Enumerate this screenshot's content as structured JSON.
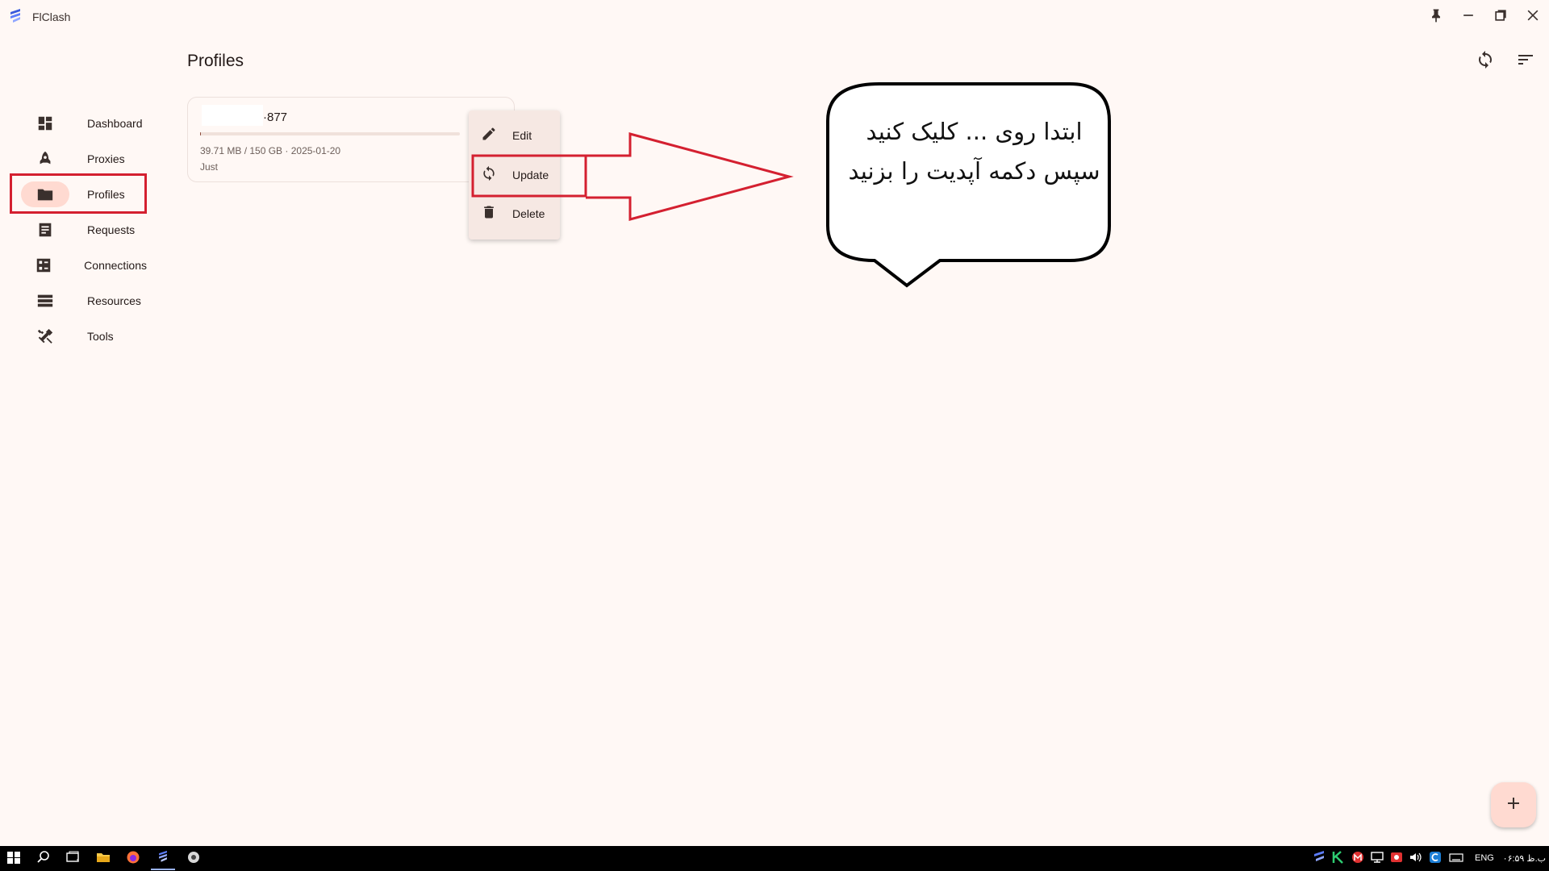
{
  "app": {
    "title": "FlClash"
  },
  "window_controls": [
    {
      "name": "pin-icon"
    },
    {
      "name": "minimize-icon"
    },
    {
      "name": "maximize-icon"
    },
    {
      "name": "close-icon"
    }
  ],
  "sidebar": {
    "items": [
      {
        "label": "Dashboard",
        "icon": "dashboard-icon"
      },
      {
        "label": "Proxies",
        "icon": "rocket-icon"
      },
      {
        "label": "Profiles",
        "icon": "folder-icon",
        "active": true
      },
      {
        "label": "Requests",
        "icon": "request-icon"
      },
      {
        "label": "Connections",
        "icon": "connections-icon"
      },
      {
        "label": "Resources",
        "icon": "storage-icon"
      },
      {
        "label": "Tools",
        "icon": "tools-icon"
      }
    ]
  },
  "page": {
    "title": "Profiles",
    "actions": [
      {
        "icon": "sync-icon"
      },
      {
        "icon": "sort-icon"
      }
    ]
  },
  "profile_card": {
    "name": "·877",
    "usage": "39.71 MB / 150 GB · 2025-01-20",
    "updated": "Just",
    "usage_fraction": 0.0003
  },
  "context_menu": {
    "items": [
      {
        "label": "Edit",
        "icon": "edit-icon"
      },
      {
        "label": "Update",
        "icon": "update-icon"
      },
      {
        "label": "Delete",
        "icon": "delete-icon"
      }
    ]
  },
  "annotation": {
    "line1": "ابتدا روی ... کلیک کنید",
    "line2": "سپس دکمه آپدیت را بزنید",
    "highlight_color": "#D42030"
  },
  "fab": {
    "icon": "add-icon"
  },
  "taskbar": {
    "language": "ENG",
    "clock": "ب.ظ ۰۶:۵۹"
  },
  "colors": {
    "background": "#FFF8F5",
    "active_nav": "#FFDAD1",
    "menu": "#F6E8E3",
    "accent": "#8E4E3E"
  }
}
